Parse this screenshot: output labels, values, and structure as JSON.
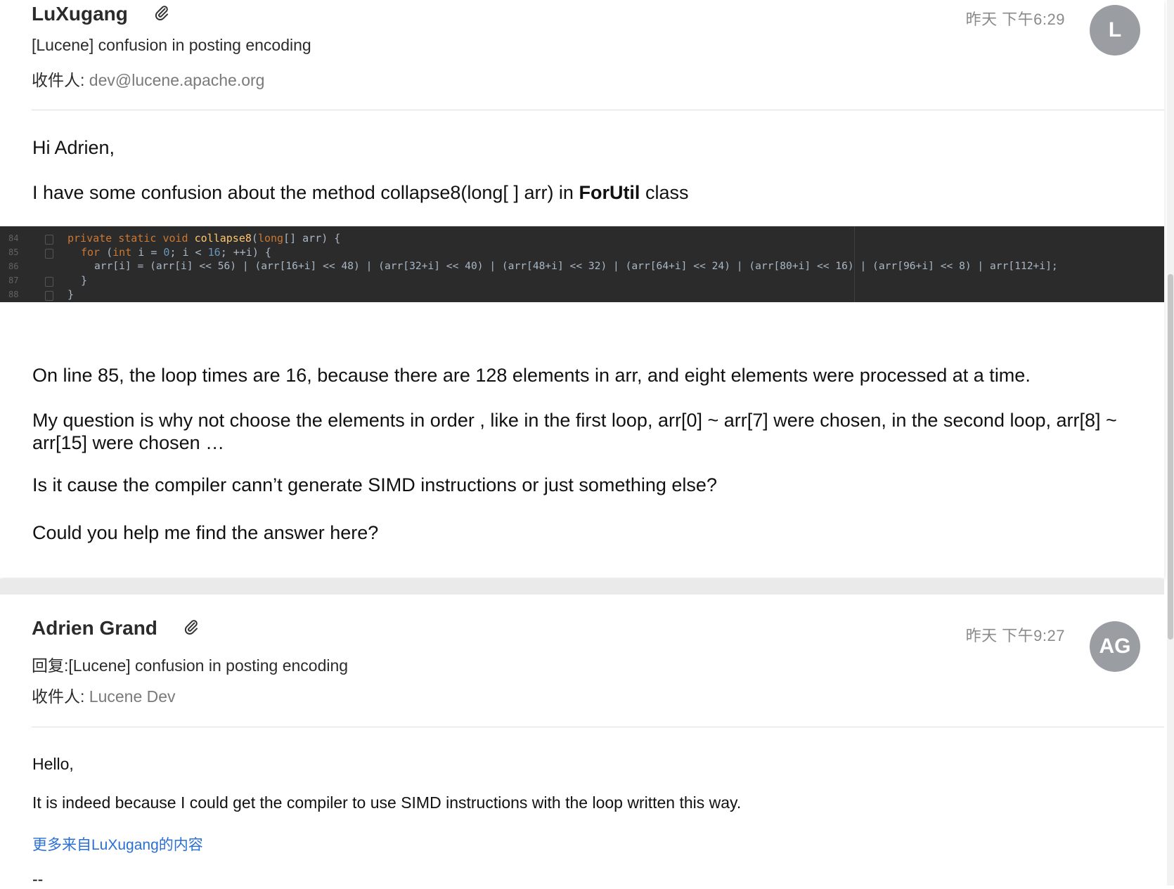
{
  "message1": {
    "sender": "LuXugang",
    "time": "昨天 下午6:29",
    "avatar_initials": "L",
    "subject": "[Lucene] confusion in posting encoding",
    "recipient_label": "收件人:",
    "recipient": "dev@lucene.apache.org",
    "greeting": "Hi Adrien,",
    "intro_prefix": "I have some confusion about the method collapse8(long[ ] arr) in ",
    "intro_bold": "ForUtil",
    "intro_suffix": " class",
    "code": {
      "line_numbers": [
        "84",
        "85",
        "86",
        "87",
        "88"
      ],
      "line1": {
        "kw": "private static void ",
        "fn": "collapse8",
        "rest": "(",
        "kw2": "long",
        "rest2": "[] arr) {"
      },
      "line2": {
        "kw": "for ",
        "p1": "(",
        "kw2": "int ",
        "p2": "i = ",
        "n1": "0",
        "p3": "; i < ",
        "n2": "16",
        "p4": "; ++i) {"
      },
      "line3": "arr[i] = (arr[i] << 56) | (arr[16+i] << 48) | (arr[32+i] << 40) | (arr[48+i] << 32) | (arr[64+i] << 24) | (arr[80+i] << 16) | (arr[96+i] << 8) | arr[112+i];",
      "line4": "}",
      "line5": "}"
    },
    "para1": "On line 85, the loop times are 16, because there are 128 elements in arr, and eight elements were processed at a time.",
    "para2": "My question is why not choose the elements in order , like in the first loop, arr[0] ~ arr[7] were chosen, in the second loop, arr[8] ~ arr[15] were chosen …",
    "para3": "Is it cause the compiler cann’t generate SIMD instructions or just something else?",
    "para4": "Could you help me find the answer here?"
  },
  "message2": {
    "sender": "Adrien Grand",
    "time": "昨天 下午9:27",
    "avatar_initials": "AG",
    "subject": "回复:[Lucene] confusion in posting encoding",
    "recipient_label": "收件人:",
    "recipient": "Lucene Dev",
    "greeting": "Hello,",
    "para1": "It is indeed because I could get the compiler to use SIMD instructions with the loop written this way.",
    "more_link": "更多来自LuXugang的内容",
    "signature_sep": "--"
  },
  "icons": {
    "attachment": "paperclip-icon"
  }
}
